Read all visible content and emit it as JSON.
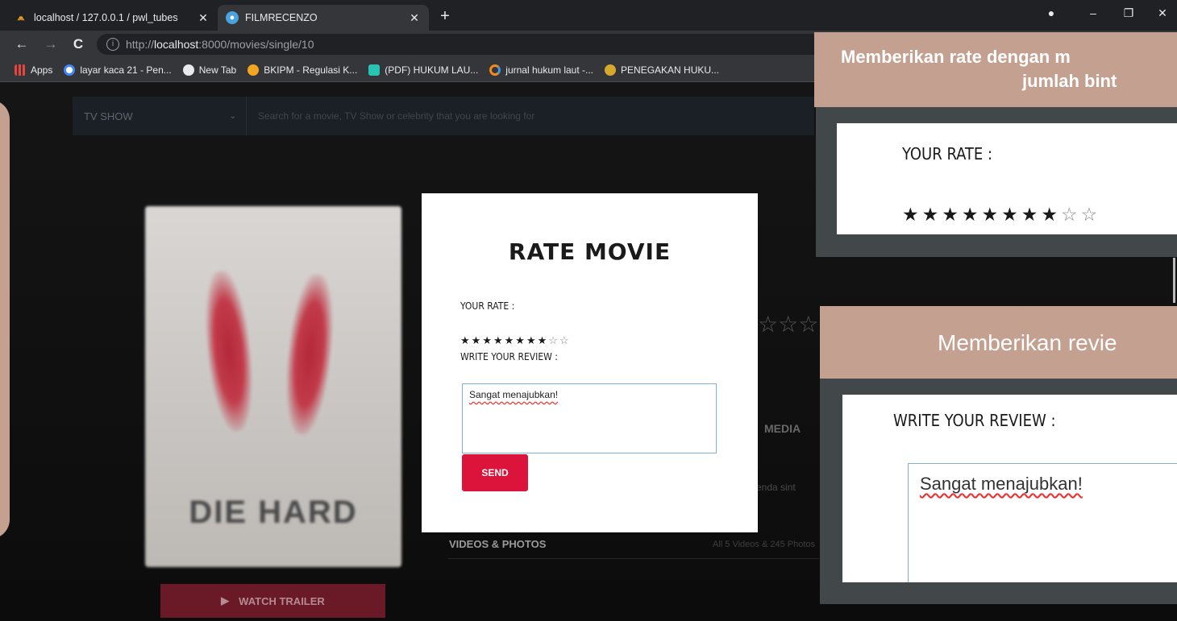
{
  "browser": {
    "tabs": [
      {
        "title": "localhost / 127.0.0.1 / pwl_tubes",
        "favicon": "phpmyadmin-icon",
        "active": false
      },
      {
        "title": "FILMRECENZO",
        "favicon": "film-icon",
        "active": true
      }
    ],
    "new_tab": "+",
    "url_scheme": "http://",
    "url_host": "localhost",
    "url_rest": ":8000/movies/single/10",
    "bookmarks": [
      {
        "label": "Apps",
        "icon": "apps-grid-icon",
        "color": "#e8453c"
      },
      {
        "label": "layar kaca 21 - Pen...",
        "icon": "google-icon",
        "color": "#4285f4"
      },
      {
        "label": "New Tab",
        "icon": "globe-icon",
        "color": "#e8eaed"
      },
      {
        "label": "BKIPM - Regulasi K...",
        "icon": "bkipm-icon",
        "color": "#f4a623"
      },
      {
        "label": "(PDF) HUKUM LAU...",
        "icon": "researchgate-icon",
        "color": "#27c4b4"
      },
      {
        "label": "jurnal hukum laut -...",
        "icon": "jurnal-icon",
        "color": "#f28b1f"
      },
      {
        "label": "PENEGAKAN HUKU...",
        "icon": "penegakan-icon",
        "color": "#d6a82c"
      }
    ]
  },
  "page": {
    "nav_category": "TV SHOW",
    "search_placeholder": "Search for a movie, TV Show or celebrity that you are looking for",
    "poster_title": "DIE HARD",
    "trailer_label": "WATCH TRAILER",
    "media_tab": "MEDIA",
    "videos_label": "VIDEOS & PHOTOS",
    "videos_count": "All 5 Videos & 245 Photos",
    "snippet": "enda sint"
  },
  "modal": {
    "title": "RATE MOVIE",
    "rate_label": "YOUR RATE :",
    "rating": 8,
    "max_rating": 10,
    "review_label": "WRITE YOUR REVIEW :",
    "review_value": "Sangat menajubkan!",
    "send_label": "SEND"
  },
  "annotations": {
    "rate_heading_line1": "Memberikan rate dengan m",
    "rate_heading_line2": "jumlah bint",
    "rate_zoom_label": "YOUR RATE :",
    "review_heading": "Memberikan revie",
    "review_zoom_label": "WRITE YOUR REVIEW :",
    "review_zoom_value": "Sangat menajubkan!"
  },
  "colors": {
    "accent": "#dc143c",
    "annotation": "#c4a090",
    "frame": "#42474a"
  }
}
